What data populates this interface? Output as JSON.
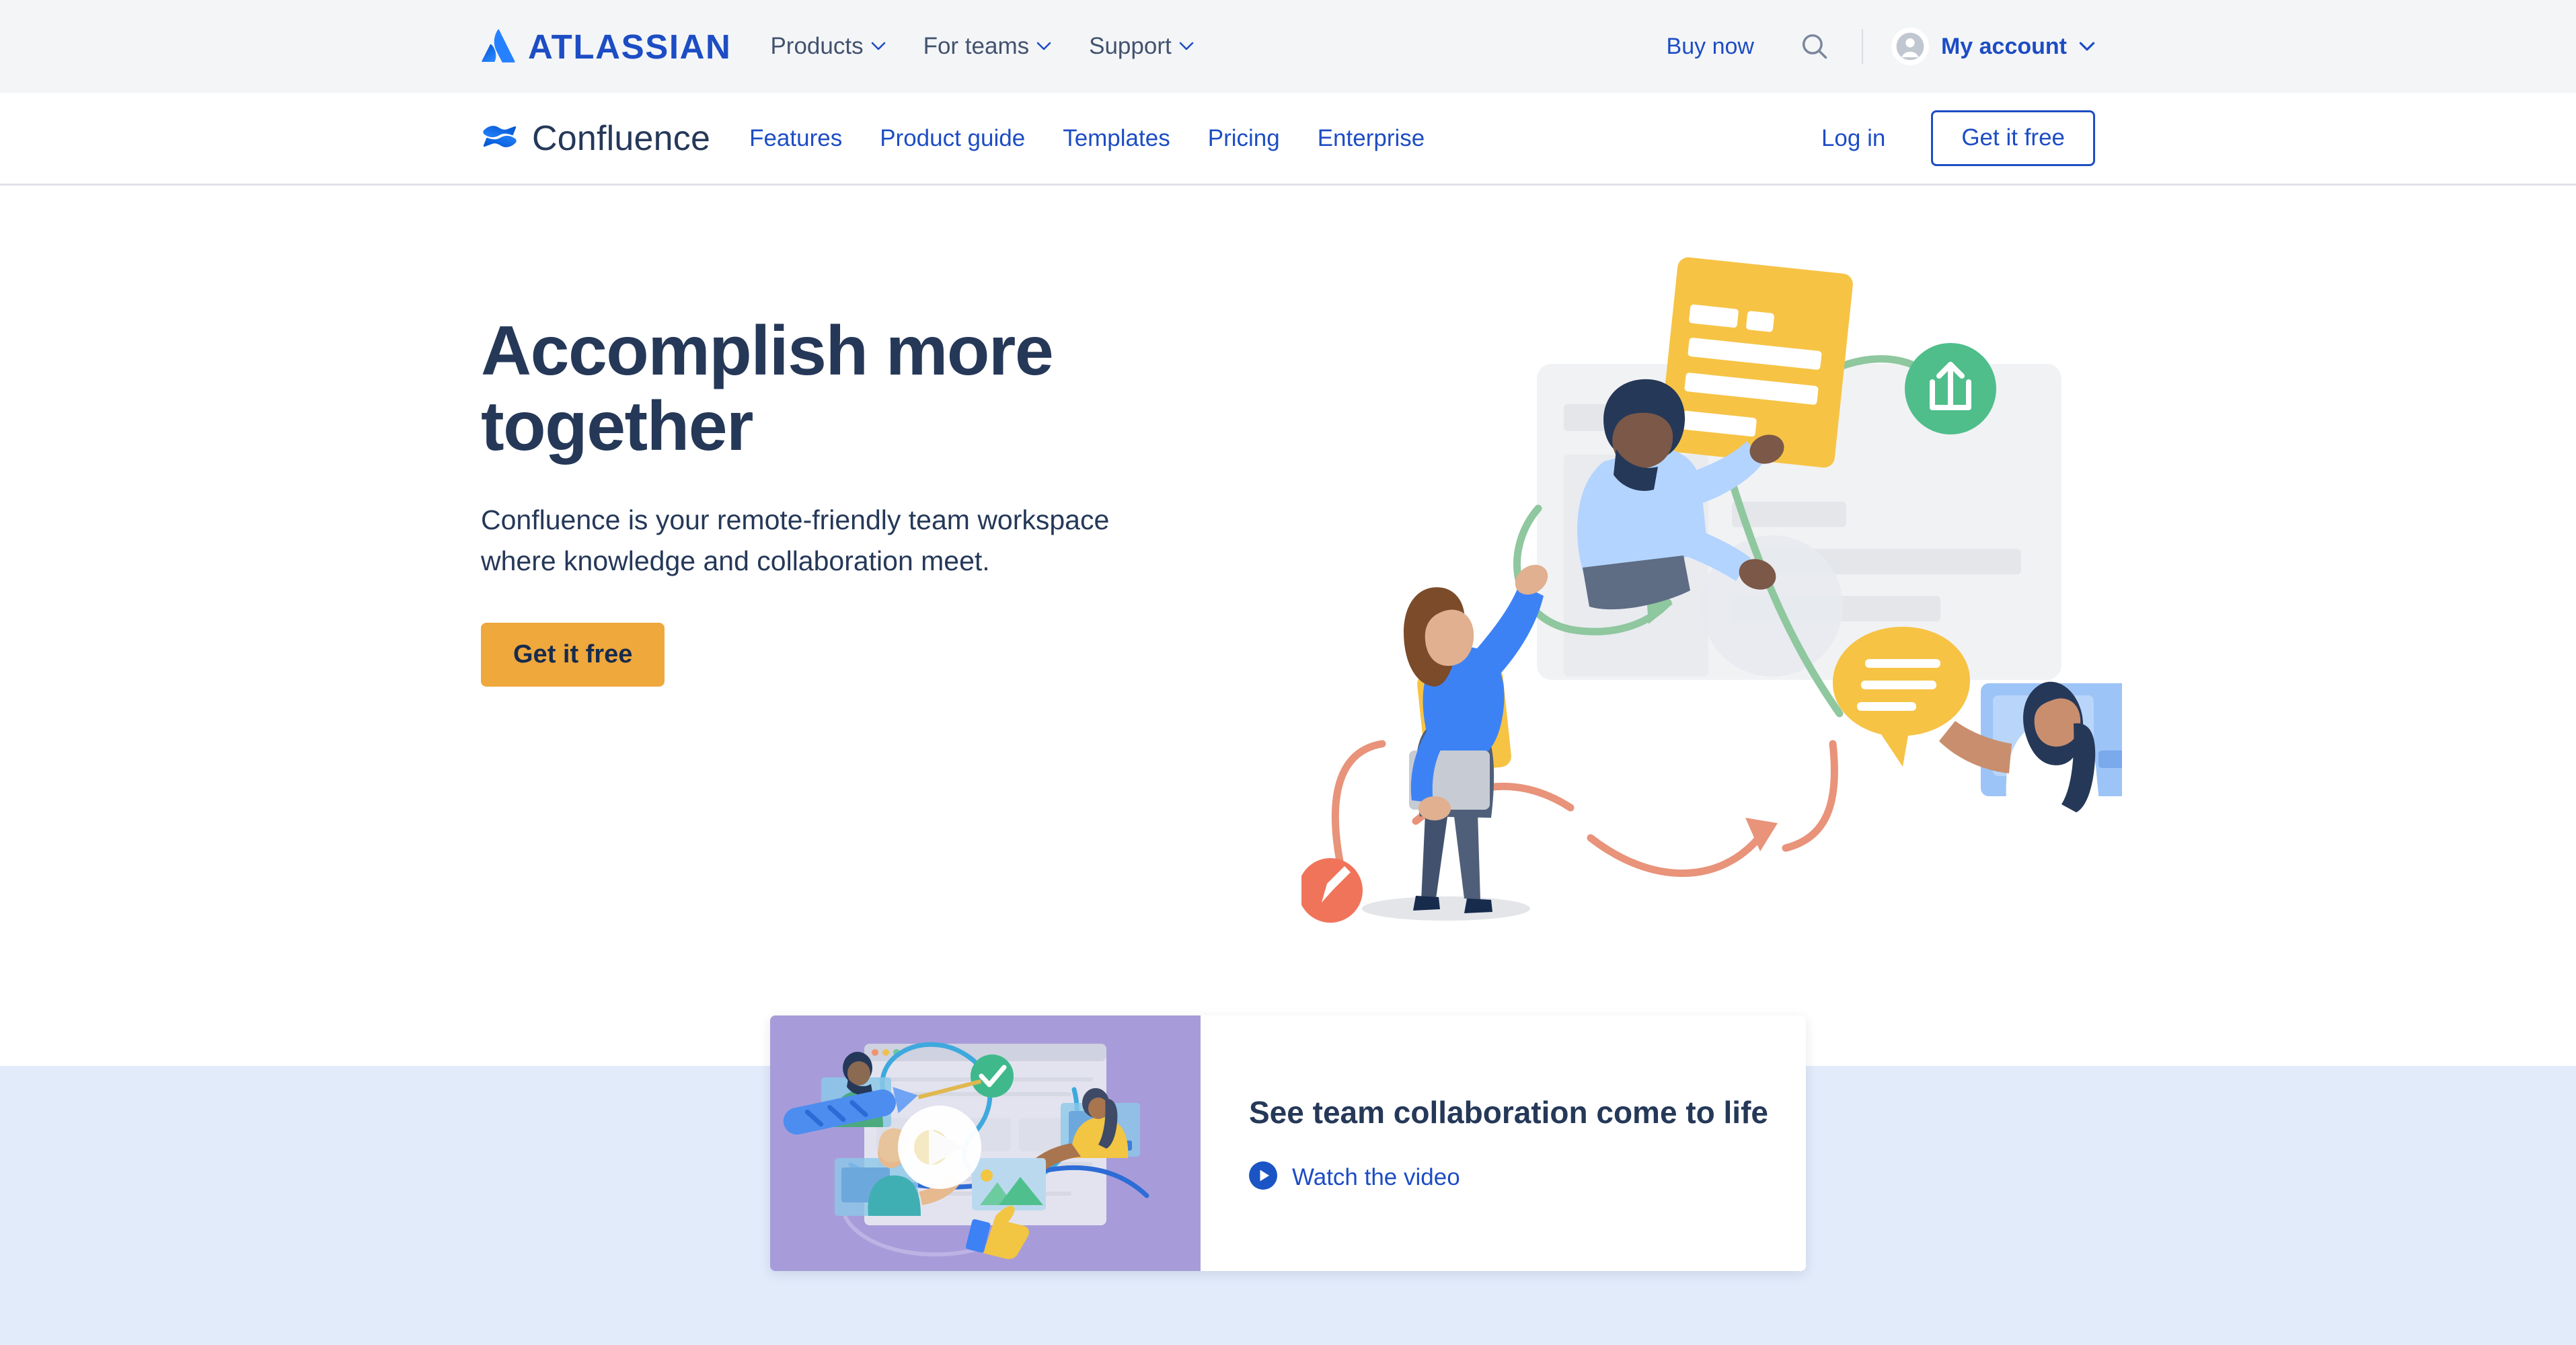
{
  "atlassian_bar": {
    "brand": "ATLASSIAN",
    "brand_logo_icon": "atlassian-logo-icon",
    "nav": [
      {
        "label": "Products",
        "icon": "chevron-down-icon"
      },
      {
        "label": "For teams",
        "icon": "chevron-down-icon"
      },
      {
        "label": "Support",
        "icon": "chevron-down-icon"
      }
    ],
    "buy_now": "Buy now",
    "search_icon": "search-icon",
    "account": {
      "label": "My account",
      "avatar_icon": "user-avatar-icon",
      "chevron_icon": "chevron-down-icon"
    }
  },
  "confluence_nav": {
    "brand": "Confluence",
    "brand_logo_icon": "confluence-logo-icon",
    "links": [
      "Features",
      "Product guide",
      "Templates",
      "Pricing",
      "Enterprise"
    ],
    "login": "Log in",
    "cta": "Get it free"
  },
  "hero": {
    "title": "Accomplish more together",
    "subtitle": "Confluence is your remote-friendly team workspace where knowledge and collaboration meet.",
    "cta": "Get it free",
    "illustration_icon": "team-collaboration-illustration"
  },
  "video_card": {
    "title": "See team collaboration come to life",
    "link_label": "Watch the video",
    "play_icon": "play-icon",
    "link_play_icon": "play-circle-icon",
    "thumbnail_icon": "video-thumbnail-illustration"
  },
  "colors": {
    "atlassian_blue": "#1D4DC4",
    "text_navy": "#253858",
    "text_slate": "#42526E",
    "cta_amber": "#EFA83C",
    "topbar_gray": "#F4F5F7",
    "band_blue": "#E1EBFA",
    "thumb_purple": "#A79CD9"
  }
}
